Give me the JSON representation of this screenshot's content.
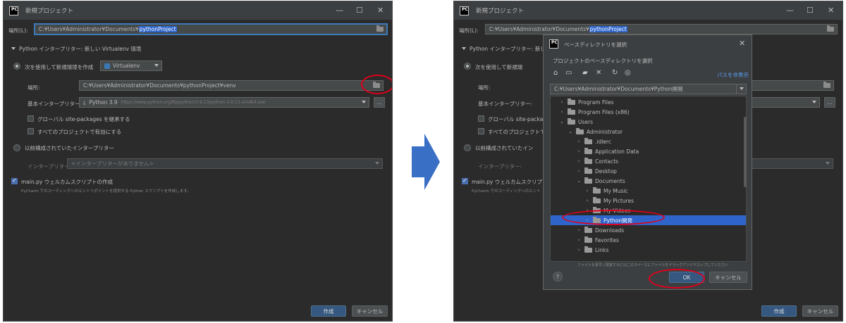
{
  "left": {
    "title": "新規プロジェクト",
    "location_label": "場所(L):",
    "location_prefix": "C:¥Users¥Administrator¥Documents¥",
    "location_selected": "pythonProject",
    "interp_section": "Python インタープリター: 新しい Virtualenv 環境",
    "new_env_radio": "次を使用して新規環境を作成",
    "env_type": "Virtualenv",
    "place_label": "場所:",
    "venv_path": "C:¥Users¥Administrator¥Documents¥pythonProject¥venv",
    "base_interp_label": "基本インタープリター:",
    "base_interp": "Python 3.9",
    "base_interp_path": "https://www.python.org/ftp/python/3.9.13/python-3.9.13-amd64.exe",
    "inherit_check": "グローバル site-packages を継承する",
    "all_projects_check": "すべてのプロジェクトで有効にする",
    "prev_interp_radio": "以前構成されていたインタープリター",
    "interp_label": "インタープリター:",
    "interp_placeholder": "<インタープリターがありません>",
    "welcome_check": "main.py ウェルカムスクリプトの作成",
    "welcome_hint": "PyCharm でのコーディングへのエントリポイントを提供する Python スクリプトを作成します。",
    "create_btn": "作成",
    "cancel_btn": "キャンセル",
    "more_btn": "..."
  },
  "right": {
    "title": "新規プロジェクト",
    "location_label": "場所(L):",
    "location_prefix": "C:¥Users¥Administrator¥Documents¥",
    "location_selected": "pythonProject",
    "interp_section": "Python インタープリター: 新しい",
    "new_env_radio": "次を使用して新規環",
    "place_label": "場所:",
    "base_interp_label": "基本インタープリター:",
    "inherit_check": "グローバル site-packag",
    "all_projects_check": "すべてのプロジェクトで有",
    "prev_interp_radio": "以前構成されていたイン",
    "interp_label": "インタープリター:",
    "welcome_check": "main.py ウェルカムスクリプトの",
    "welcome_hint": "PyCharm でのコーディングへのエント",
    "create_btn": "作成",
    "cancel_btn": "キャンセル"
  },
  "chooser": {
    "title": "ベースディレクトリを選択",
    "subtitle": "プロジェクトのベースディレクトリを選択",
    "hide_path": "パスを非表示",
    "path_value": "C:¥Users¥Administrator¥Documents¥Python開発",
    "tree": [
      {
        "label": "Program Files",
        "expanded": false
      },
      {
        "label": "Program Files (x86)",
        "expanded": false
      },
      {
        "label": "Users",
        "expanded": true
      },
      {
        "label": "Administrator",
        "expanded": true
      },
      {
        "label": ".idlerc",
        "expanded": false
      },
      {
        "label": "Application Data",
        "expanded": false
      },
      {
        "label": "Contacts",
        "expanded": false
      },
      {
        "label": "Desktop",
        "expanded": false
      },
      {
        "label": "Documents",
        "expanded": true
      },
      {
        "label": "My Music",
        "expanded": false
      },
      {
        "label": "My Pictures",
        "expanded": false
      },
      {
        "label": "My Videos",
        "expanded": false
      },
      {
        "label": "Python開発",
        "expanded": false,
        "selected": true
      },
      {
        "label": "Downloads",
        "expanded": false
      },
      {
        "label": "Favorites",
        "expanded": false
      },
      {
        "label": "Links",
        "expanded": false
      }
    ],
    "drop_hint": "ファイルを素早く配置するにはこのスペースにファイルをドラッグアンドドロップしてください",
    "help": "?",
    "ok_btn": "OK",
    "cancel_btn": "キャンセル"
  },
  "colors": {
    "arrow": "#3a6fc6",
    "highlight": "#e0001b",
    "dialog_bg": "#2b2b2b",
    "selection": "#2f65ca"
  }
}
